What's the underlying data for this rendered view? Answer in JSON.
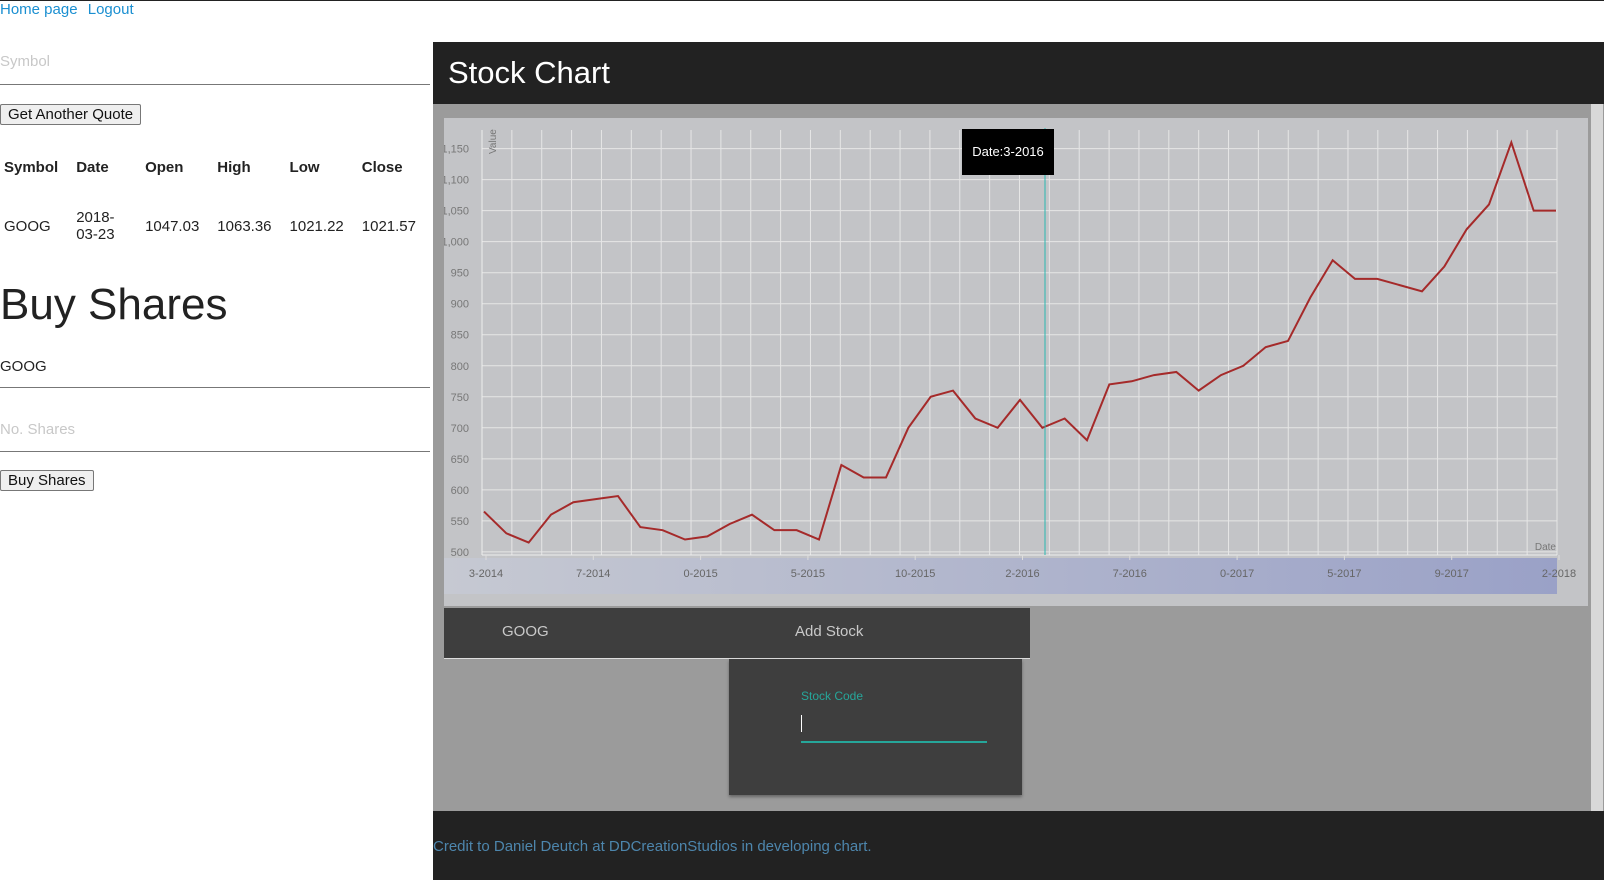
{
  "nav": {
    "home": "Home page",
    "logout": "Logout"
  },
  "quote": {
    "symbol_placeholder": "Symbol",
    "button": "Get Another Quote",
    "headers": [
      "Symbol",
      "Date",
      "Open",
      "High",
      "Low",
      "Close"
    ],
    "row": [
      "GOOG",
      "2018-03-23",
      "1047.03",
      "1063.36",
      "1021.22",
      "1021.57"
    ]
  },
  "buy": {
    "heading": "Buy Shares",
    "symbol_value": "GOOG",
    "shares_placeholder": "No. Shares",
    "button": "Buy Shares"
  },
  "stock_chart": {
    "title": "Stock Chart",
    "tooltip": "Date:3-2016",
    "tabs": [
      "GOOG",
      "Add Stock"
    ],
    "stock_code_label": "Stock Code",
    "stock_code_value": ""
  },
  "footer": {
    "credit": "Credit to Daniel Deutch at DDCreationStudios in developing chart."
  },
  "colors": {
    "line": "#a52a2a",
    "accent": "#26a69a",
    "link": "#1a8fd1"
  },
  "chart_data": {
    "type": "line",
    "xlabel": "Date",
    "ylabel": "Value",
    "ylim": [
      495,
      1180
    ],
    "yticks": [
      500,
      550,
      600,
      650,
      700,
      750,
      800,
      850,
      900,
      950,
      1000,
      1050,
      1100,
      1150
    ],
    "ytick_labels": [
      "500",
      "550",
      "600",
      "650",
      "700",
      "750",
      "800",
      "850",
      "900",
      "950",
      "1,000",
      "1,050",
      "1,100",
      "1,150"
    ],
    "xtick_labels": [
      "3-2014",
      "7-2014",
      "0-2015",
      "5-2015",
      "10-2015",
      "2-2016",
      "7-2016",
      "0-2017",
      "5-2017",
      "9-2017",
      "2-2018"
    ],
    "grid": true,
    "series": [
      {
        "x": [
          "2014-03",
          "2014-04",
          "2014-05",
          "2014-06",
          "2014-07",
          "2014-08",
          "2014-09",
          "2014-10",
          "2014-11",
          "2014-12",
          "2015-01",
          "2015-02",
          "2015-03",
          "2015-04",
          "2015-05",
          "2015-06",
          "2015-07",
          "2015-08",
          "2015-09",
          "2015-10",
          "2015-11",
          "2015-12",
          "2016-01",
          "2016-02",
          "2016-03",
          "2016-04",
          "2016-05",
          "2016-06",
          "2016-07",
          "2016-08",
          "2016-09",
          "2016-10",
          "2016-11",
          "2016-12",
          "2017-01",
          "2017-02",
          "2017-03",
          "2017-04",
          "2017-05",
          "2017-06",
          "2017-07",
          "2017-08",
          "2017-09",
          "2017-10",
          "2017-11",
          "2017-12",
          "2018-01",
          "2018-02",
          "2018-03"
        ],
        "values": [
          565,
          530,
          515,
          560,
          580,
          585,
          590,
          540,
          535,
          520,
          525,
          545,
          560,
          535,
          535,
          520,
          640,
          620,
          620,
          700,
          750,
          760,
          715,
          700,
          745,
          700,
          715,
          680,
          770,
          775,
          785,
          790,
          760,
          785,
          800,
          830,
          840,
          910,
          970,
          940,
          940,
          930,
          920,
          960,
          1020,
          1060,
          1160,
          1050,
          1050
        ]
      }
    ]
  }
}
